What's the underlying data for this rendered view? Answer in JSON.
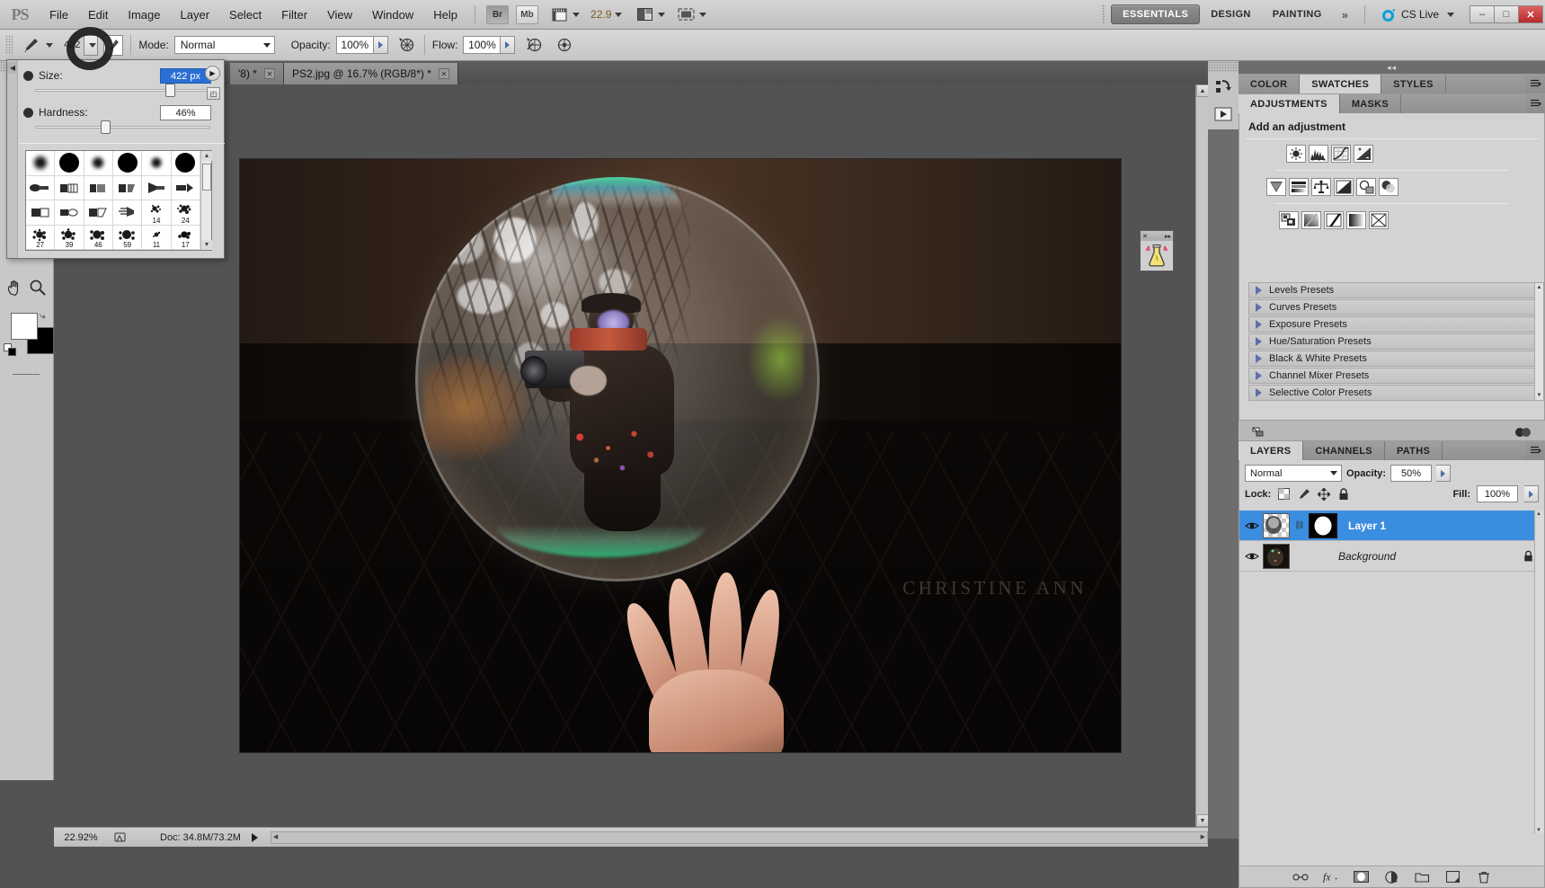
{
  "app": {
    "logo": "PS"
  },
  "menubar": {
    "items": [
      "File",
      "Edit",
      "Image",
      "Layer",
      "Select",
      "Filter",
      "View",
      "Window",
      "Help"
    ],
    "bridge_label": "Br",
    "minibridge_label": "Mb",
    "zoom_value": "22.9",
    "workspaces": [
      "ESSENTIALS",
      "DESIGN",
      "PAINTING"
    ],
    "workspace_active": "ESSENTIALS",
    "more_workspaces": "»",
    "cs_live": "CS Live",
    "win_minimize": "–",
    "win_restore": "□",
    "win_close": "✕"
  },
  "options_bar": {
    "tool_icon": "brush-tool-icon",
    "brush_size_preview": "422",
    "mode_label": "Mode:",
    "mode_value": "Normal",
    "opacity_label": "Opacity:",
    "opacity_value": "100%",
    "flow_label": "Flow:",
    "flow_value": "100%"
  },
  "brush_panel": {
    "size_label": "Size:",
    "size_value": "422 px",
    "hardness_label": "Hardness:",
    "hardness_value": "46%",
    "presets": [
      {
        "num": "",
        "kind": "soft-round"
      },
      {
        "num": "",
        "kind": "hard-round"
      },
      {
        "num": "",
        "kind": "soft-round"
      },
      {
        "num": "",
        "kind": "hard-round"
      },
      {
        "num": "",
        "kind": "soft-round"
      },
      {
        "num": "",
        "kind": "hard-round"
      },
      {
        "num": "",
        "kind": "flat-a"
      },
      {
        "num": "",
        "kind": "flat-b"
      },
      {
        "num": "",
        "kind": "flat-c"
      },
      {
        "num": "",
        "kind": "flat-d"
      },
      {
        "num": "",
        "kind": "fan"
      },
      {
        "num": "",
        "kind": "flat-e"
      },
      {
        "num": "",
        "kind": "flat-f"
      },
      {
        "num": "",
        "kind": "flat-g"
      },
      {
        "num": "",
        "kind": "flat-h"
      },
      {
        "num": "",
        "kind": "fan2"
      },
      {
        "num": "14",
        "kind": "spatter"
      },
      {
        "num": "24",
        "kind": "spatter"
      },
      {
        "num": "27",
        "kind": "spatter"
      },
      {
        "num": "39",
        "kind": "spatter"
      },
      {
        "num": "46",
        "kind": "spatter"
      },
      {
        "num": "59",
        "kind": "spatter"
      },
      {
        "num": "11",
        "kind": "spatter"
      },
      {
        "num": "17",
        "kind": "spatter"
      }
    ]
  },
  "document_tabs": [
    {
      "label": "'8) *",
      "active": false,
      "close": "✕"
    },
    {
      "label": "PS2.jpg @ 16.7% (RGB/8*) *",
      "active": true,
      "close": "✕"
    }
  ],
  "canvas": {
    "watermark": "CHRISTINE ANN"
  },
  "status_bar": {
    "zoom": "22.92%",
    "doc": "Doc: 34.8M/73.2M"
  },
  "right_dock": {
    "group1_tabs": [
      "COLOR",
      "SWATCHES",
      "STYLES"
    ],
    "group1_active": "SWATCHES",
    "group2_tabs": [
      "ADJUSTMENTS",
      "MASKS"
    ],
    "group2_active": "ADJUSTMENTS",
    "adjustments_title": "Add an adjustment",
    "adjustment_icons_row1": [
      "brightness-contrast-icon",
      "levels-icon",
      "curves-icon",
      "exposure-icon"
    ],
    "adjustment_icons_row2": [
      "vibrance-icon",
      "hue-saturation-icon",
      "color-balance-icon",
      "black-white-icon",
      "photo-filter-icon",
      "channel-mixer-icon"
    ],
    "adjustment_icons_row3": [
      "invert-icon",
      "posterize-icon",
      "threshold-icon",
      "gradient-map-icon",
      "selective-color-icon"
    ],
    "presets": [
      "Levels Presets",
      "Curves Presets",
      "Exposure Presets",
      "Hue/Saturation Presets",
      "Black & White Presets",
      "Channel Mixer Presets",
      "Selective Color Presets"
    ],
    "layers_tabs": [
      "LAYERS",
      "CHANNELS",
      "PATHS"
    ],
    "layers_active": "LAYERS",
    "blend_mode": "Normal",
    "opacity_label": "Opacity:",
    "opacity_value": "50%",
    "lock_label": "Lock:",
    "fill_label": "Fill:",
    "fill_value": "100%",
    "layers": [
      {
        "name": "Layer 1",
        "selected": true,
        "has_mask": true,
        "locked": false,
        "visible": true
      },
      {
        "name": "Background",
        "selected": false,
        "has_mask": false,
        "locked": true,
        "visible": true
      }
    ],
    "layer_buttons": [
      "link-layers-icon",
      "layer-style-icon",
      "layer-mask-icon",
      "adjustment-layer-icon",
      "new-group-icon",
      "new-layer-icon",
      "delete-layer-icon"
    ]
  }
}
